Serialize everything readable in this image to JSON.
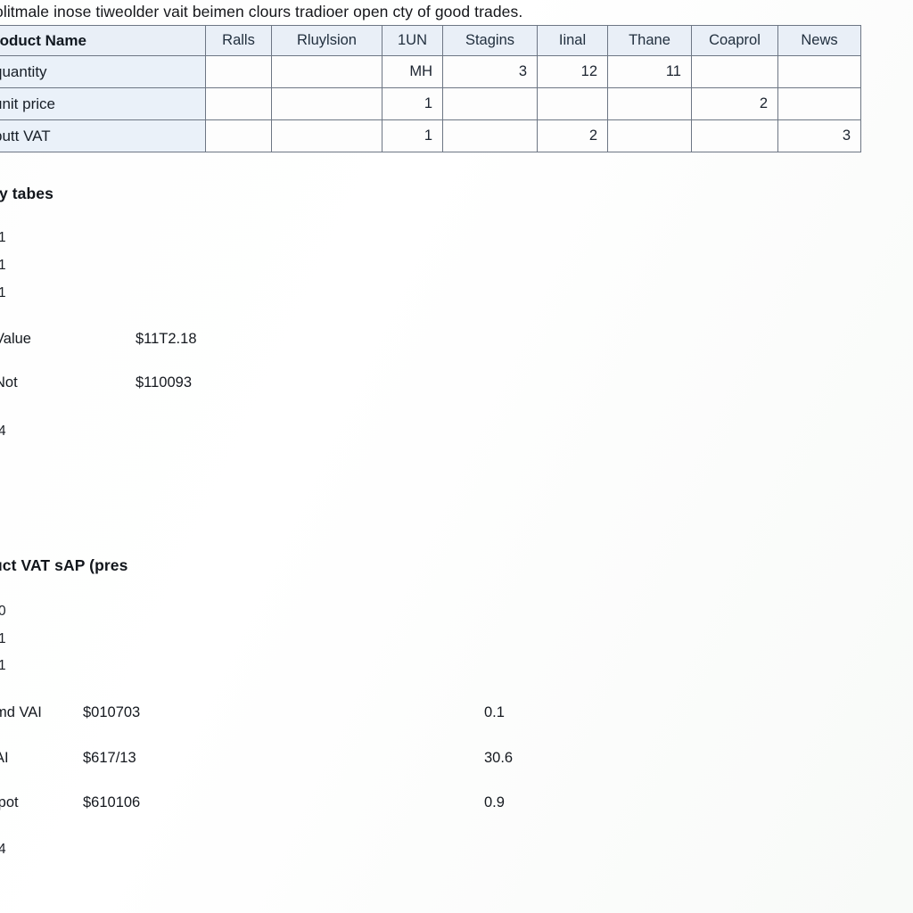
{
  "document": {
    "intro_text": "olitmale inose tiweolder vait beimen clours tradioer open cty of good trades."
  },
  "table": {
    "headers": [
      "roduct  Name",
      "Ralls",
      "Rluylsion",
      "1UN",
      "Stagins",
      "Iinal",
      "Thane",
      "Coaprol",
      "News"
    ],
    "rows": [
      {
        "name": "quantity",
        "cells": [
          "",
          "",
          "MH",
          "3",
          "12",
          "11",
          "",
          ""
        ]
      },
      {
        "name": "unit price",
        "cells": [
          "",
          "",
          "1",
          "",
          "",
          "",
          "2",
          ""
        ]
      },
      {
        "name": "putt VAT",
        "cells": [
          "",
          "",
          "1",
          "",
          "2",
          "",
          "",
          "3"
        ]
      }
    ]
  },
  "section_one": {
    "heading": "ly tabes",
    "mini_numbers": [
      "1",
      "1",
      "1"
    ],
    "summary": [
      {
        "label": "Value",
        "value": "$11T2.18"
      },
      {
        "label": "Not",
        "value": "$110093"
      }
    ],
    "trailing_number": "4"
  },
  "section_two": {
    "heading": "uct VAT sAP (pres",
    "mini_numbers": [
      "0",
      "1",
      "1"
    ],
    "summary": [
      {
        "label": "md VAI",
        "value": "$010703",
        "extra": "0.1"
      },
      {
        "label": "AI",
        "value": "$617/13",
        "extra": "30.6"
      },
      {
        "label": "ipot",
        "value": "$610106",
        "extra": "0.9"
      }
    ],
    "trailing_number": "4"
  },
  "colors": {
    "header_bg": "#e9eff7",
    "name_col_bg": "#eaf1f9",
    "grid_line": "#6d7684",
    "text": "#15191f"
  }
}
